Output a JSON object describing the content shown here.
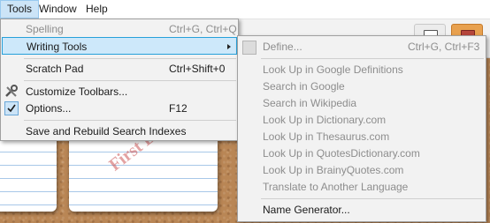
{
  "menubar": {
    "tools": "Tools",
    "window": "Window",
    "help": "Help"
  },
  "tools_menu": {
    "spelling": "Spelling",
    "spelling_accel": "Ctrl+G, Ctrl+Q",
    "writing_tools": "Writing Tools",
    "scratch_pad": "Scratch Pad",
    "scratch_pad_accel": "Ctrl+Shift+0",
    "customize_toolbars": "Customize Toolbars...",
    "options": "Options...",
    "options_accel": "F12",
    "save_rebuild": "Save and Rebuild Search Indexes"
  },
  "writing_tools_menu": {
    "define": "Define...",
    "define_accel": "Ctrl+G, Ctrl+F3",
    "items": [
      "Look Up in Google Definitions",
      "Search in Google",
      "Search in Wikipedia",
      "Look Up in Dictionary.com",
      "Look Up in Thesaurus.com",
      "Look Up in QuotesDictionary.com",
      "Look Up in BrainyQuotes.com",
      "Translate to Another Language"
    ],
    "name_generator": "Name Generator..."
  },
  "background": {
    "stamp_text": "First D"
  },
  "colors": {
    "menu_bg": "#f2f2f2",
    "highlight": "#91c9f7",
    "disabled": "#8d8d8d",
    "cork": "#b98655"
  },
  "icons": [
    "spelling-icon",
    "writing-tools-icon",
    "customize-toolbars-icon",
    "options-check-icon",
    "define-icon"
  ]
}
